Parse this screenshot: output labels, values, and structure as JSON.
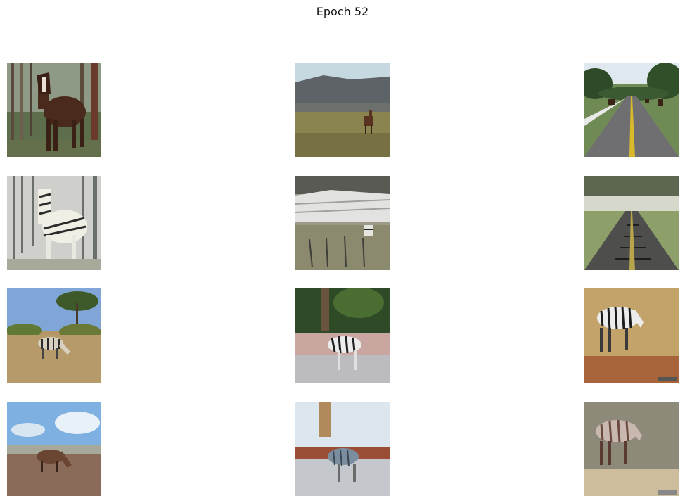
{
  "figure": {
    "title": "Epoch 52"
  }
}
